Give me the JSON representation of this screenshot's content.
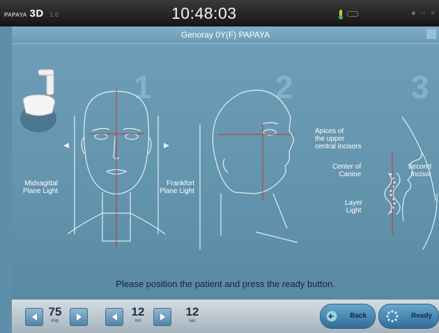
{
  "titlebar": {
    "logo_small": "PAPAYA",
    "logo_big": "3D",
    "version": "1.0",
    "time": "10:48:03",
    "minimize": "–",
    "close": "×"
  },
  "subheader": {
    "title": "Genoray  0Y(F)  PAPAYA"
  },
  "steps": [
    {
      "number": "1",
      "label": [
        "Midsagittal",
        "Plane Light"
      ]
    },
    {
      "number": "2",
      "label": [
        "Frankfort",
        "Plane Light"
      ]
    },
    {
      "number": "3"
    }
  ],
  "step3_labels": {
    "apices": [
      "Apices of",
      "the upper",
      "central incisors"
    ],
    "canine": [
      "Center of",
      "Canine"
    ],
    "second_incisor": [
      "Second",
      "Incisor"
    ],
    "layer": [
      "Layer",
      "Light"
    ]
  },
  "instruction": "Please position the patient and press the ready button.",
  "controls": {
    "kvp": {
      "value": "75",
      "unit": "kVp"
    },
    "ma": {
      "value": "12",
      "unit": "mA"
    },
    "sec": {
      "value": "12",
      "unit": "sec"
    }
  },
  "buttons": {
    "back": "Back",
    "ready": "Ready"
  },
  "colors": {
    "background": "#6394ad",
    "titlebar": "#151515",
    "accent": "#4e86a8"
  }
}
